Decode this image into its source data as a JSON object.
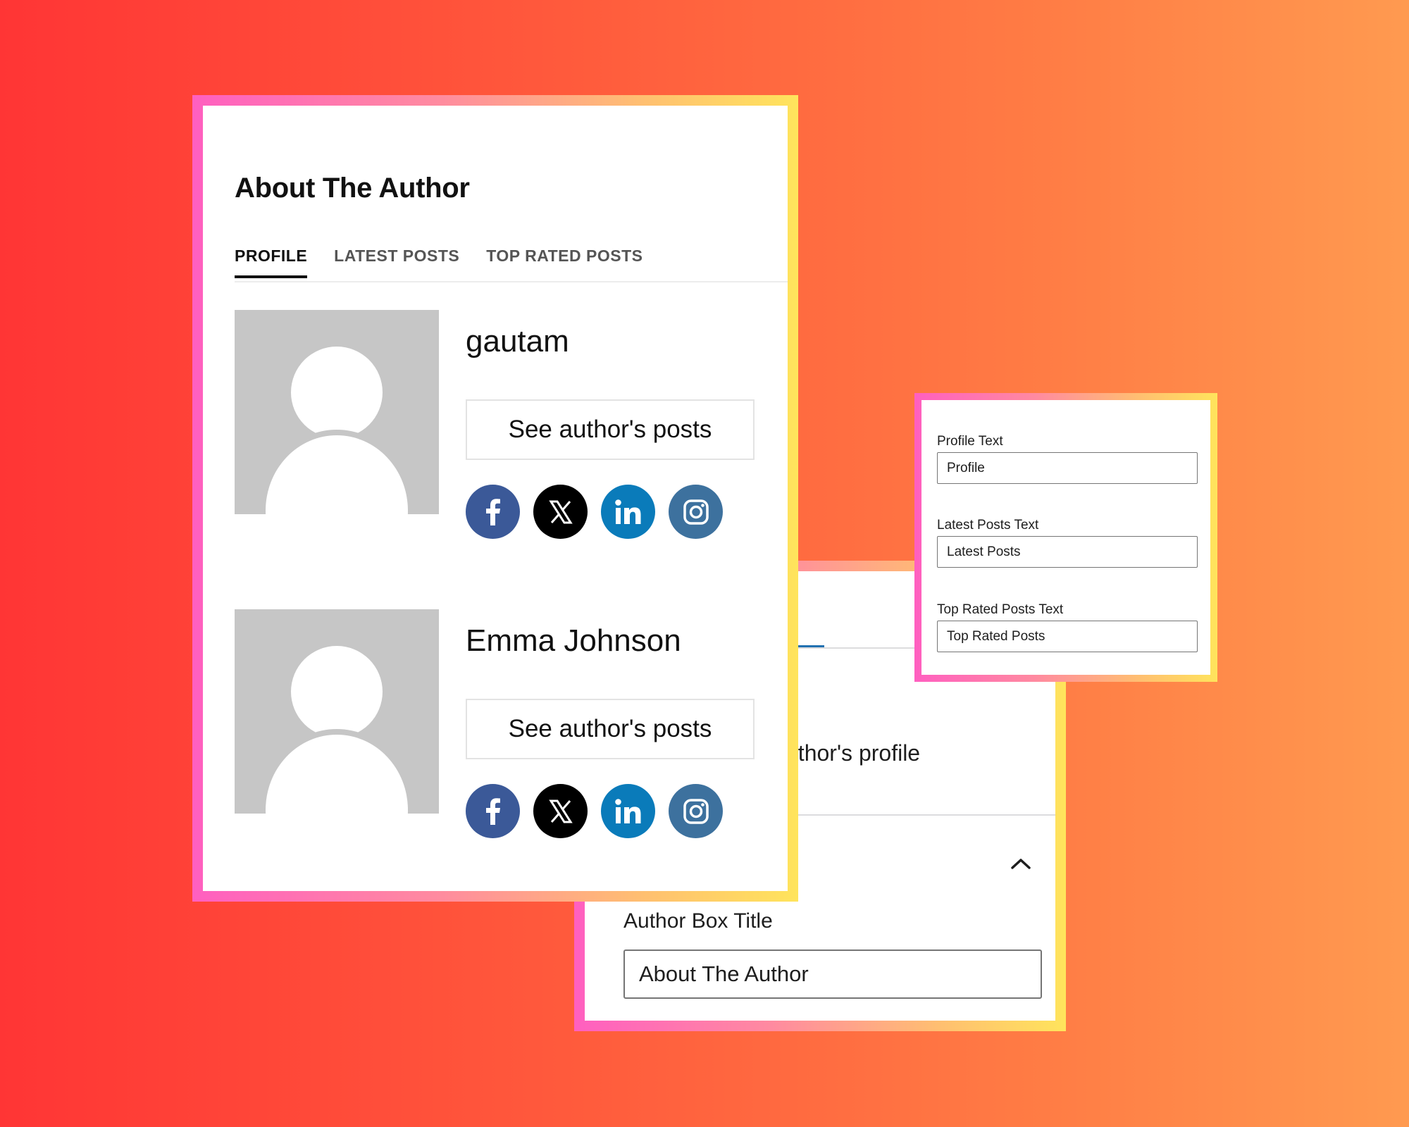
{
  "settings_panel": {
    "link_text_fragment": "uthor's profile",
    "author_box_title_label": "Author Box Title",
    "author_box_title_value": "About The Author"
  },
  "author_box": {
    "title": "About The Author",
    "tabs": [
      {
        "label": "PROFILE",
        "active": true
      },
      {
        "label": "LATEST POSTS",
        "active": false
      },
      {
        "label": "TOP RATED POSTS",
        "active": false
      }
    ],
    "authors": [
      {
        "name": "gautam",
        "button_label": "See author's posts",
        "socials": [
          "facebook-icon",
          "x-icon",
          "linkedin-icon",
          "instagram-icon"
        ]
      },
      {
        "name": "Emma Johnson",
        "button_label": "See author's posts",
        "socials": [
          "facebook-icon",
          "x-icon",
          "linkedin-icon",
          "instagram-icon"
        ]
      }
    ]
  },
  "text_settings": {
    "fields": [
      {
        "label": "Profile Text",
        "value": "Profile"
      },
      {
        "label": "Latest Posts Text",
        "value": "Latest Posts"
      },
      {
        "label": "Top Rated Posts Text",
        "value": "Top Rated Posts"
      }
    ]
  },
  "colors": {
    "facebook": "#3b5998",
    "x": "#000000",
    "linkedin": "#0a7bba",
    "instagram": "#3d719e",
    "frame_gradient": [
      "#ff5fc0",
      "#ffe45c"
    ],
    "background_gradient": [
      "#ff3535",
      "#ff9a50"
    ]
  }
}
